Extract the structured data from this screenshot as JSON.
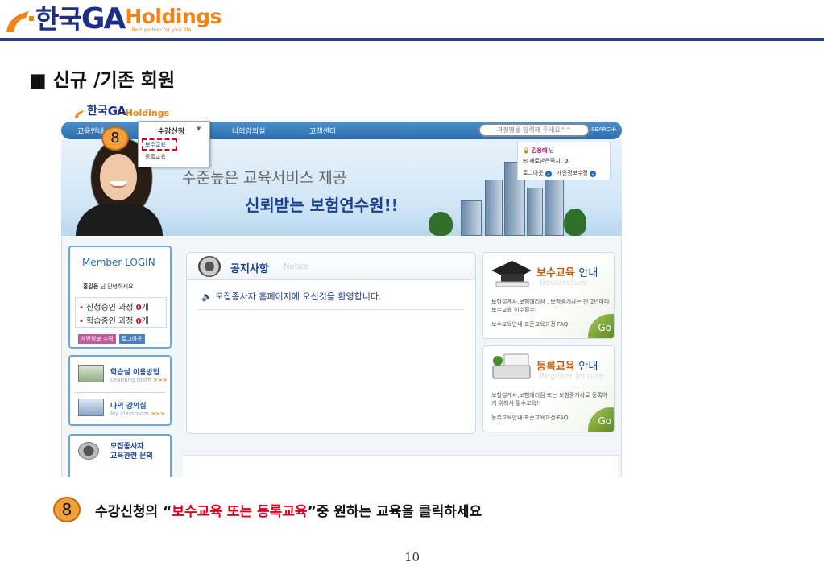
{
  "brand": {
    "logo_ko": "한국",
    "logo_ga": "GA",
    "logo_holdings": "Holdings",
    "logo_tagline": "Best partner for your life"
  },
  "section_title": "■ 신규 /기존 회원",
  "site": {
    "nav": {
      "items": [
        "교육안내",
        "나의강의실",
        "고객센터"
      ],
      "dropdown_title": "수강신청",
      "dropdown_items": [
        "보수교육",
        "등록교육"
      ],
      "search_placeholder": "과정명을 입력해 주세요^^",
      "search_button": "SEARCH"
    },
    "step_badge": "8",
    "banner": {
      "line1": "수준높은 교육서비스 제공",
      "line2": "신뢰받는 보험연수원!!"
    },
    "userbox": {
      "name": "김용태",
      "suffix": "님",
      "messages_label": "새로받은쪽지:",
      "messages_count": "0",
      "logout": "로그아웃",
      "edit_info": "개인정보수정"
    },
    "login": {
      "title": "Member LOGIN",
      "user_name": "홍길동",
      "user_greeting": "님 안녕하세요",
      "rows": [
        {
          "label": "신청중인 과정",
          "count": "0",
          "unit": "개"
        },
        {
          "label": "학습중인 과정",
          "count": "0",
          "unit": "개"
        }
      ],
      "btn_edit": "개인정보 수정",
      "btn_logout": "로그아웃"
    },
    "sidebar": [
      {
        "title": "학습실 이용방법",
        "sub": "Learning room",
        "arrows": ">>>"
      },
      {
        "title": "나의 강의실",
        "sub": "My classroom",
        "arrows": ">>>"
      },
      {
        "title": "모집종사자",
        "title2": "교육관련 문의",
        "sub": "",
        "arrows": ""
      }
    ],
    "notice": {
      "title": "공지사항",
      "title_en": "Notice",
      "item": "모집종사자 홈페이지에 오신것을 환영합니다."
    },
    "cards": [
      {
        "title": "보수교육",
        "title_suffix": "안내",
        "title_en": "Bosulecture",
        "desc": "보험설계사,보험대리점 , 보험중개사는 만 2년마다 보수교육 이수필수!",
        "links": "보수교육안내·표준교육과정·FAQ",
        "go": "Go"
      },
      {
        "title": "등록교육",
        "title_suffix": "안내",
        "title_en": "Register lecture",
        "desc": "보험설계사,보험대리점 또는 보험중개사로 등록하기 위해서 필수교육!!",
        "links": "등록교육안내·표준교육과정·FAQ",
        "go": "Go"
      }
    ]
  },
  "caption": {
    "badge": "8",
    "prefix": "수강신청의 “",
    "highlight": "보수교육 또는 등록교육",
    "suffix": "”중 원하는 교육을  클릭하세요"
  },
  "page_number": "10",
  "colors": {
    "brand_blue": "#1e2f87",
    "brand_orange": "#f08418",
    "highlight_red": "#e4001b",
    "badge_orange": "#f3a03c"
  }
}
